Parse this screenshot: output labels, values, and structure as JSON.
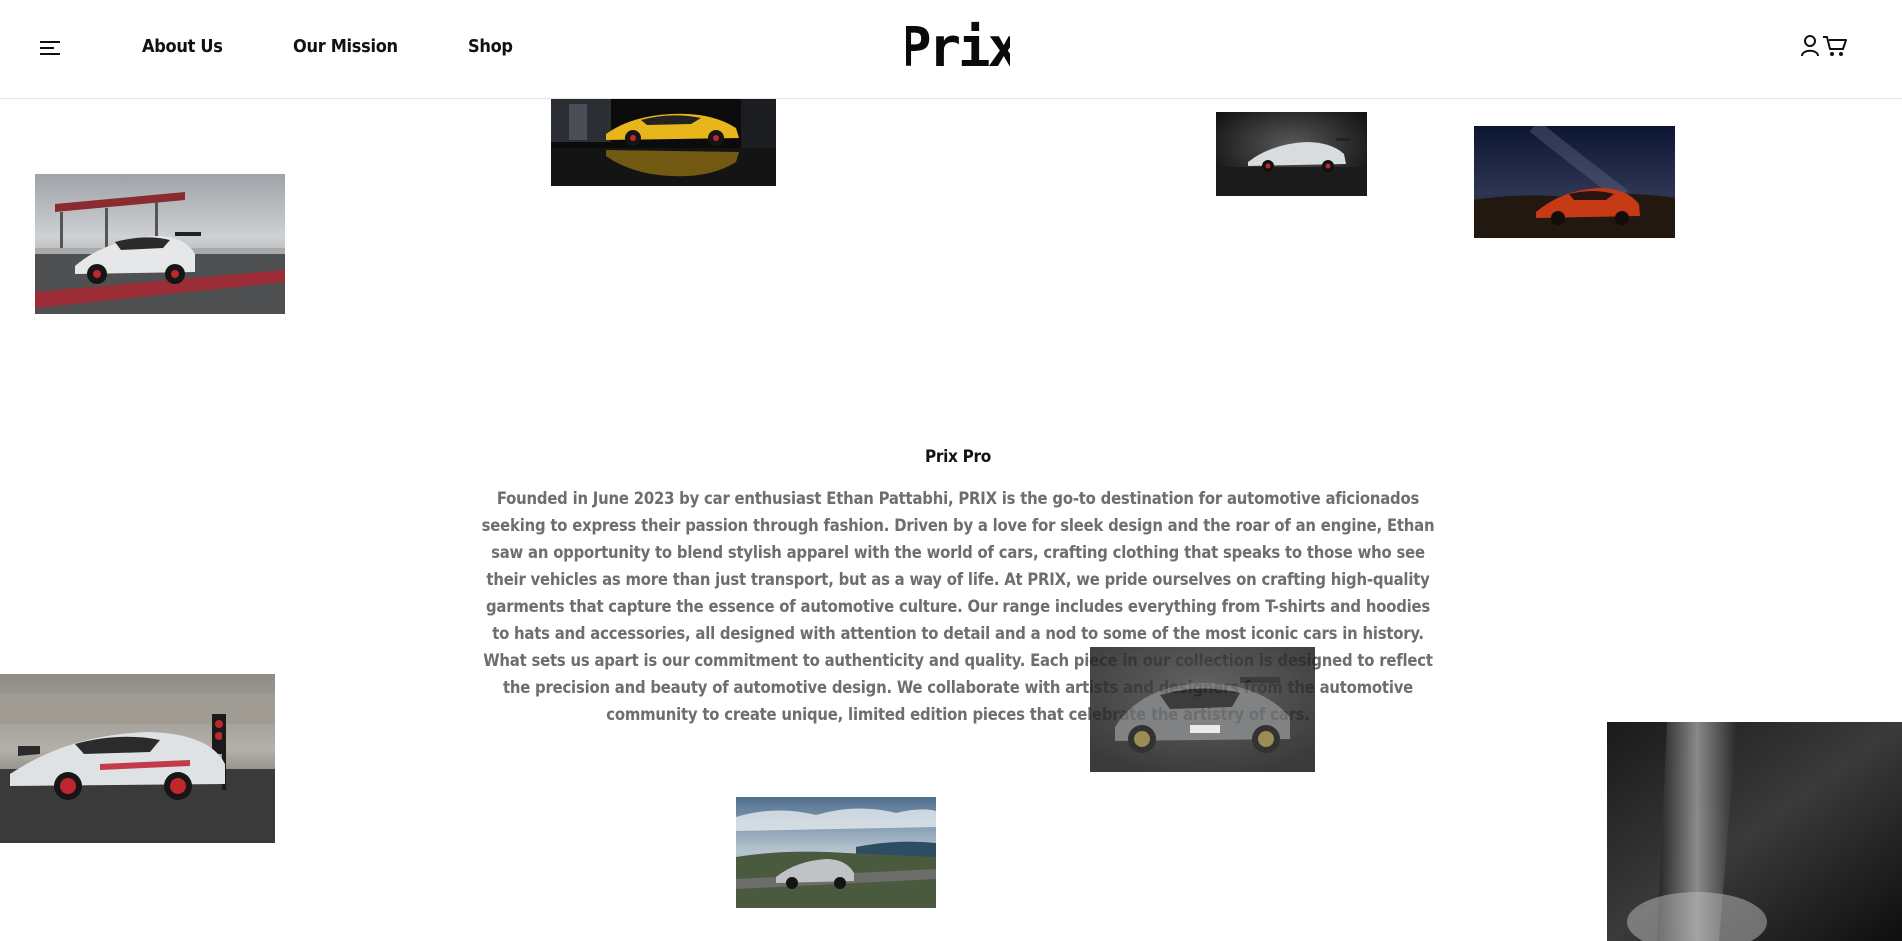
{
  "header": {
    "menu_icon": "hamburger-menu-icon",
    "nav": [
      {
        "label": "About Us"
      },
      {
        "label": "Our Mission"
      },
      {
        "label": "Shop"
      }
    ],
    "brand": "Prix",
    "user_icon": "user-icon",
    "cart_icon": "cart-icon"
  },
  "about": {
    "title": "Prix Pro",
    "body": "Founded in June 2023 by car enthusiast Ethan Pattabhi, PRIX is the go-to destination for automotive aficionados seeking to express their passion through fashion. Driven by a love for sleek design and the roar of an engine, Ethan saw an opportunity to blend stylish apparel with the world of cars, crafting clothing that speaks to those who see their vehicles as more than just transport, but as a way of life. At PRIX, we pride ourselves on crafting high-quality garments that capture the essence of automotive culture. Our range includes everything from T-shirts and hoodies to hats and accessories, all designed with attention to detail and a nod to some of the most iconic cars in history. What sets us apart is our commitment to authenticity and quality. Each piece in our collection is designed to reflect the precision and beauty of automotive design. We collaborate with artists and designers from the automotive community to create unique, limited edition pieces that celebrate the artistry of cars."
  },
  "colors": {
    "text_dark": "#111111",
    "text_body": "#6e6e6e",
    "background": "#ffffff",
    "header_border": "#e6e6e6"
  }
}
